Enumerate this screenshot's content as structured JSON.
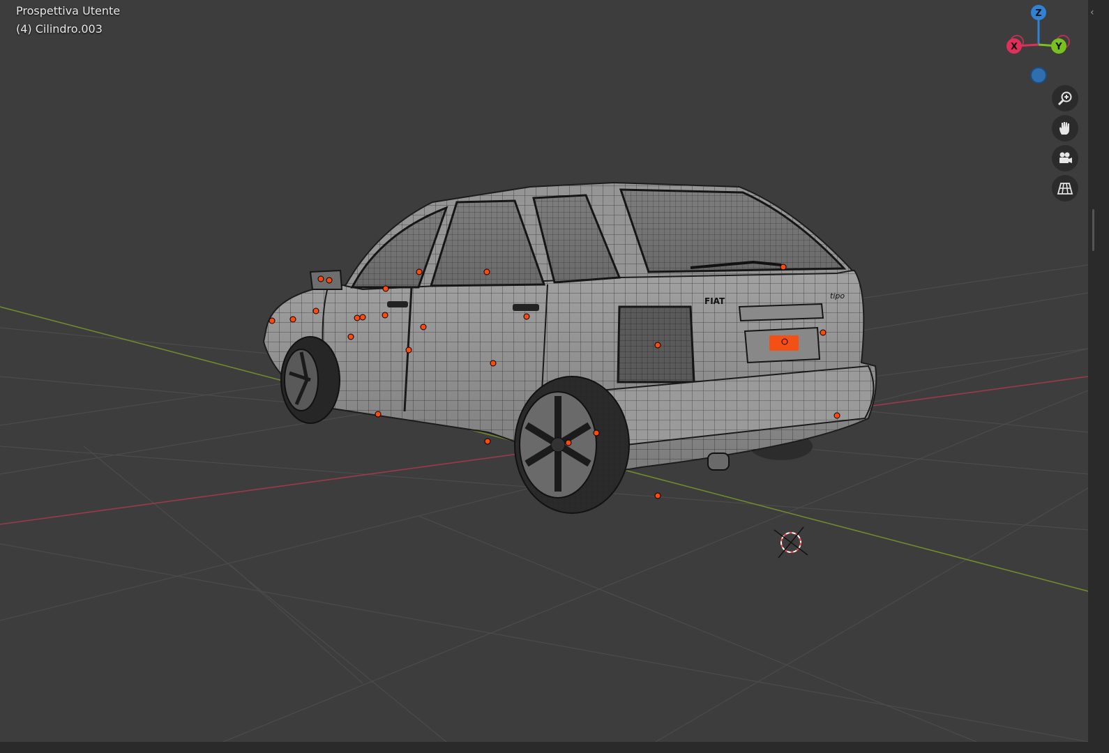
{
  "viewport": {
    "view_name": "Prospettiva Utente",
    "object_name": "(4) Cilindro.003",
    "background_color": "#3d3d3d",
    "grid_color": "#4b4b4b",
    "x_axis_color": "#9b3a48",
    "y_axis_color": "#6e8b2e"
  },
  "gizmo": {
    "z_label": "Z",
    "x_label": "X",
    "y_label": "Y",
    "z_color": "#2f83d4",
    "x_color": "#e0305a",
    "y_color": "#79c11f"
  },
  "nav_buttons": [
    {
      "name": "zoom",
      "icon": "zoom-magnifier-icon"
    },
    {
      "name": "pan",
      "icon": "hand-pan-icon"
    },
    {
      "name": "camera",
      "icon": "camera-view-icon"
    },
    {
      "name": "ortho",
      "icon": "perspective-grid-icon"
    }
  ],
  "model": {
    "body_color": "#8e8e8e",
    "wire_color": "#1e1e1e",
    "selected_color": "#ff4a0a",
    "badge_front": "FIAT",
    "badge_rear": "tipo"
  }
}
